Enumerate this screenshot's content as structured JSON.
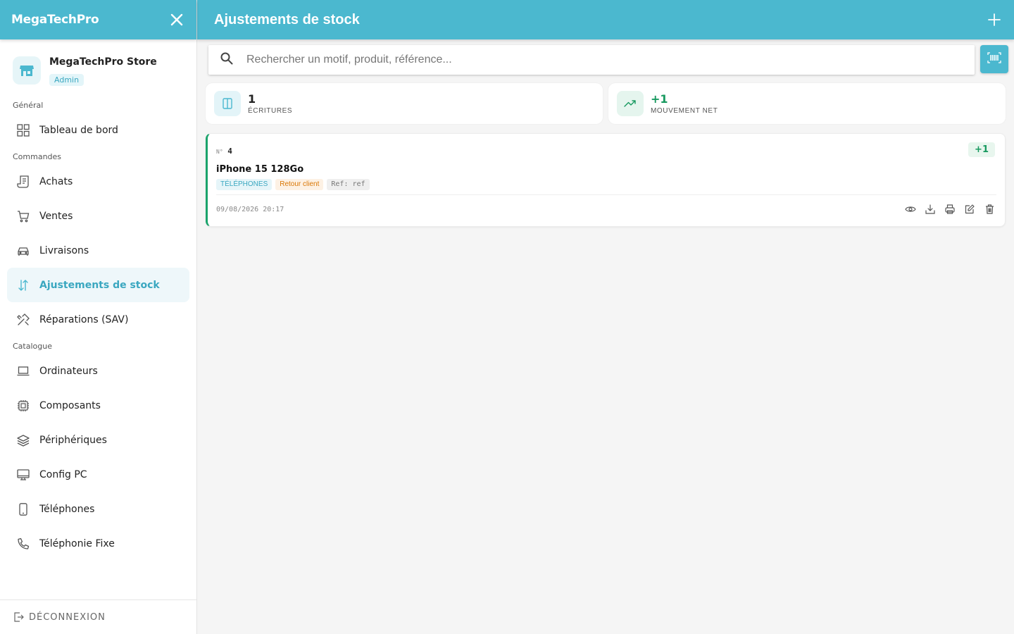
{
  "app": {
    "brand": "MegaTechPro"
  },
  "store": {
    "name": "MegaTechPro Store",
    "role": "Admin"
  },
  "sidebar": {
    "sections": [
      {
        "title": "Général"
      },
      {
        "title": "Commandes"
      },
      {
        "title": "Catalogue"
      }
    ],
    "items": [
      {
        "label": "Tableau de bord",
        "icon": "dashboard-icon"
      },
      {
        "label": "Achats",
        "icon": "receipt-icon"
      },
      {
        "label": "Ventes",
        "icon": "cart-icon"
      },
      {
        "label": "Livraisons",
        "icon": "car-icon"
      },
      {
        "label": "Ajustements de stock",
        "icon": "arrows-updown-icon",
        "active": true
      },
      {
        "label": "Réparations (SAV)",
        "icon": "tools-icon"
      },
      {
        "label": "Ordinateurs",
        "icon": "laptop-icon"
      },
      {
        "label": "Composants",
        "icon": "cpu-icon"
      },
      {
        "label": "Périphériques",
        "icon": "layers-icon"
      },
      {
        "label": "Config PC",
        "icon": "monitor-icon"
      },
      {
        "label": "Téléphones",
        "icon": "phone-icon"
      },
      {
        "label": "Téléphonie Fixe",
        "icon": "telephone-icon"
      }
    ],
    "logout": "DÉCONNEXION"
  },
  "header": {
    "title": "Ajustements de stock"
  },
  "search": {
    "placeholder": "Rechercher un motif, produit, référence..."
  },
  "stats": [
    {
      "value": "1",
      "label": "ÉCRITURES",
      "color": "#222222",
      "icon": "book-icon"
    },
    {
      "value": "+1",
      "label": "MOUVEMENT NET",
      "color": "#17995f",
      "icon": "trending-up-icon"
    }
  ],
  "entries": [
    {
      "number_label": "N°",
      "number": "4",
      "quantity": "+1",
      "product": "iPhone 15 128Go",
      "category": "TÉLÉPHONES",
      "reason": "Retour client",
      "ref": "Ref: ref",
      "date": "09/08/2026 20:17",
      "accent": "#1aa36b"
    }
  ],
  "colors": {
    "primary": "#4bb8cf",
    "positive": "#17995f",
    "warning": "#d97706"
  }
}
